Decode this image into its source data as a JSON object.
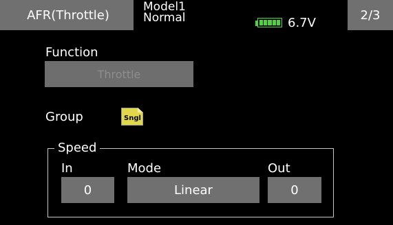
{
  "header": {
    "title": "AFR(Throttle)",
    "model_name": "Model1",
    "condition": "Normal",
    "battery_icon": "battery-icon",
    "battery_color": "#4cd63a",
    "voltage": "6.7V",
    "page": "2/3"
  },
  "function": {
    "label": "Function",
    "value": "Throttle"
  },
  "group": {
    "label": "Group",
    "icon": "single-group-icon",
    "icon_text": "Sngl"
  },
  "speed": {
    "legend": "Speed",
    "in_label": "In",
    "in_value": "0",
    "mode_label": "Mode",
    "mode_value": "Linear",
    "out_label": "Out",
    "out_value": "0"
  }
}
